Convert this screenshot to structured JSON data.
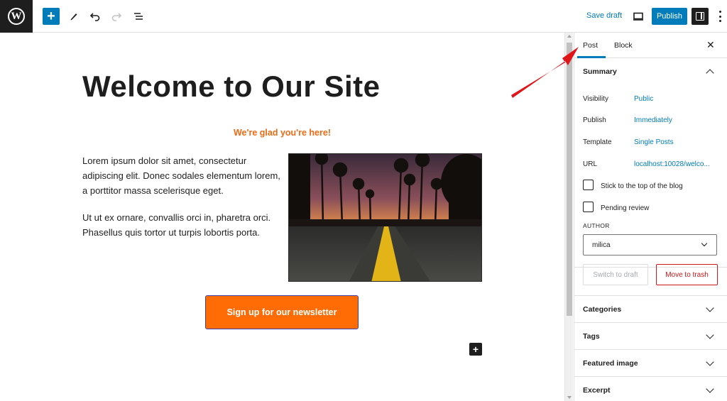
{
  "toolbar": {
    "save_draft": "Save draft",
    "publish": "Publish"
  },
  "content": {
    "title": "Welcome to Our Site",
    "tagline": "We're glad you're here!",
    "paragraph1": "Lorem ipsum dolor sit amet, consectetur adipiscing elit. Donec sodales elementum lorem, a porttitor massa scelerisque eget.",
    "paragraph2": "Ut ut ex ornare, convallis orci in, pharetra orci. Phasellus quis tortor ut turpis lobortis porta.",
    "button": "Sign up for our newsletter",
    "add_block": "+"
  },
  "sidebar": {
    "tabs": [
      "Post",
      "Block"
    ],
    "close": "✕",
    "summary": {
      "title": "Summary",
      "visibility_label": "Visibility",
      "visibility_value": "Public",
      "publish_label": "Publish",
      "publish_value": "Immediately",
      "template_label": "Template",
      "template_value": "Single Posts",
      "url_label": "URL",
      "url_value": "localhost:10028/welco...",
      "sticky_label": "Stick to the top of the blog",
      "pending_label": "Pending review",
      "author_label": "AUTHOR",
      "author_value": "milica",
      "switch_draft": "Switch to draft",
      "move_trash": "Move to trash"
    },
    "panels": [
      "Categories",
      "Tags",
      "Featured image",
      "Excerpt"
    ]
  },
  "colors": {
    "accent": "#007cba",
    "cta": "#ff6b04",
    "tagline": "#ee6a15",
    "danger": "#cc1818",
    "annotation_arrow": "#e0161b"
  }
}
